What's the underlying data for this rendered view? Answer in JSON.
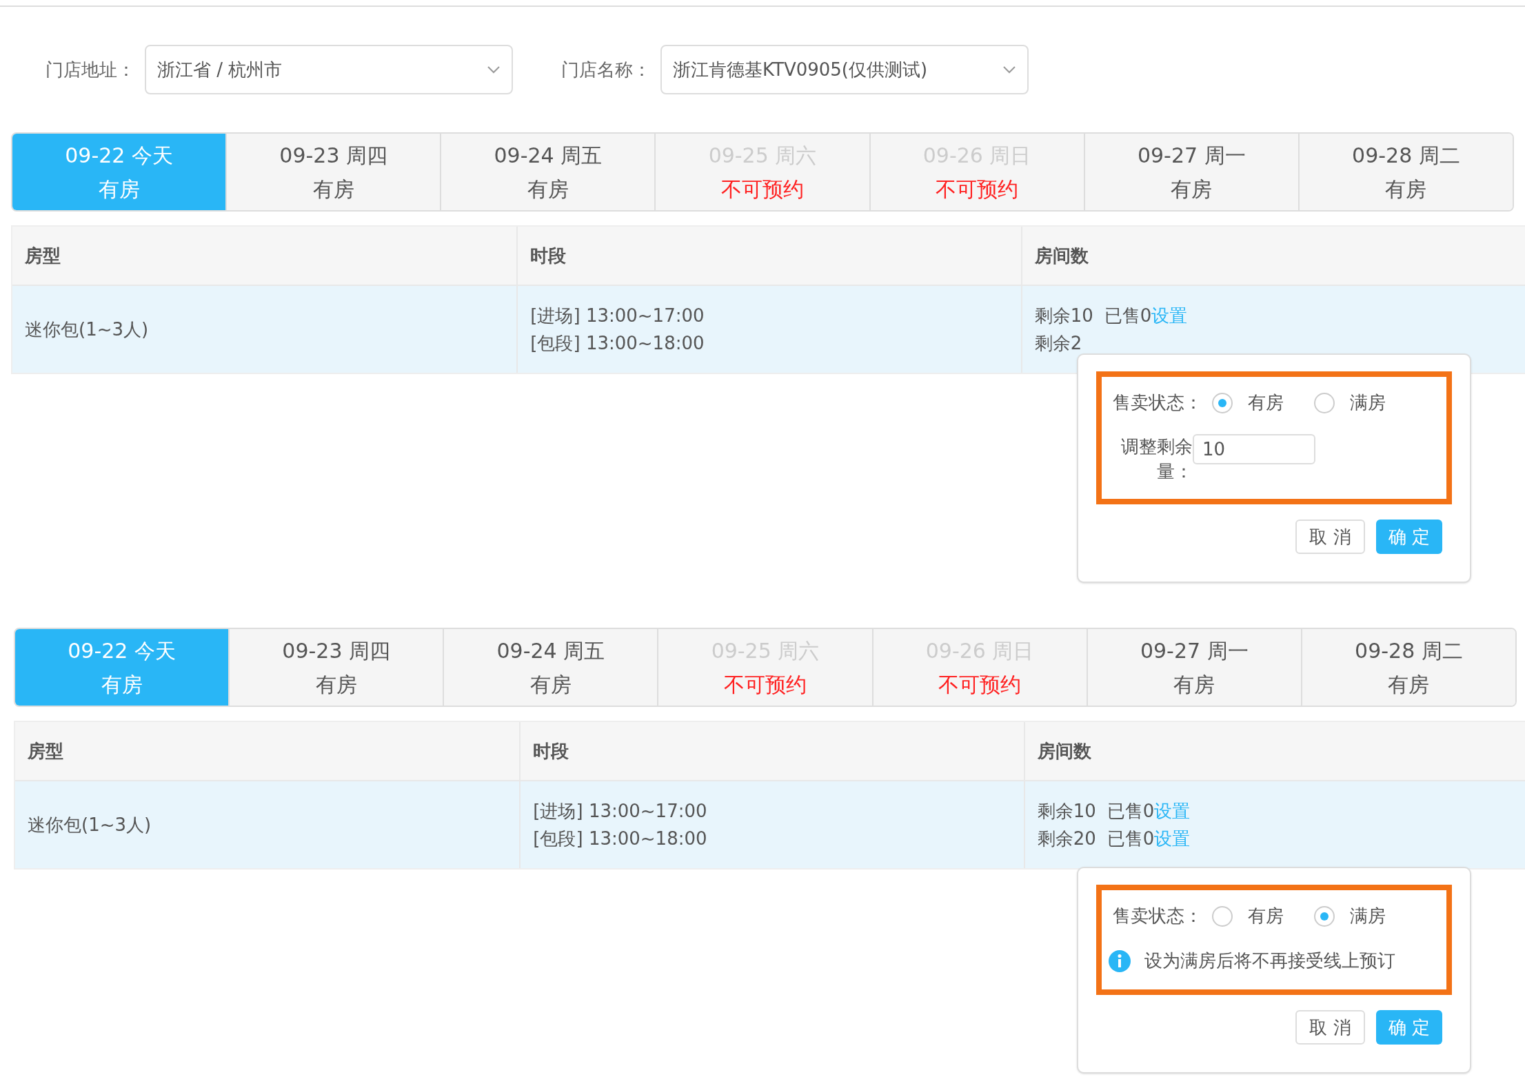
{
  "sections": [
    {
      "filters": [
        {
          "label": "门店地址：",
          "value": "浙江省 / 杭州市"
        },
        {
          "label": "门店名称：",
          "value": "浙江肯德基KTV0905(仅供测试)"
        }
      ],
      "date_tabs": [
        {
          "date": "09-22 今天",
          "status": "有房",
          "selected": true,
          "available": true
        },
        {
          "date": "09-23 周四",
          "status": "有房",
          "selected": false,
          "available": true
        },
        {
          "date": "09-24 周五",
          "status": "有房",
          "selected": false,
          "available": true
        },
        {
          "date": "09-25 周六",
          "status": "不可预约",
          "selected": false,
          "available": false
        },
        {
          "date": "09-26 周日",
          "status": "不可预约",
          "selected": false,
          "available": false
        },
        {
          "date": "09-27 周一",
          "status": "有房",
          "selected": false,
          "available": true
        },
        {
          "date": "09-28 周二",
          "status": "有房",
          "selected": false,
          "available": true
        }
      ],
      "table": {
        "columns": [
          "房型",
          "时段",
          "房间数"
        ],
        "rows": [
          {
            "room_type": "迷你包(1~3人)",
            "periods": [
              "[进场] 13:00~17:00",
              "[包段] 13:00~18:00"
            ],
            "counts": [
              {
                "remaining": "剩余10",
                "sold": "已售0",
                "link": "设置"
              },
              {
                "remaining": "剩余2"
              }
            ]
          }
        ]
      },
      "popover": {
        "label": "售卖状态：",
        "options": [
          {
            "label": "有房",
            "selected": true
          },
          {
            "label": "满房",
            "selected": false
          }
        ],
        "adjust": {
          "label": "调整剩余量：",
          "value": "10"
        },
        "buttons": [
          "取 消",
          "确 定"
        ]
      }
    },
    {
      "date_tabs": [
        {
          "date": "09-22 今天",
          "status": "有房",
          "selected": true,
          "available": true
        },
        {
          "date": "09-23 周四",
          "status": "有房",
          "selected": false,
          "available": true
        },
        {
          "date": "09-24 周五",
          "status": "有房",
          "selected": false,
          "available": true
        },
        {
          "date": "09-25 周六",
          "status": "不可预约",
          "selected": false,
          "available": false
        },
        {
          "date": "09-26 周日",
          "status": "不可预约",
          "selected": false,
          "available": false
        },
        {
          "date": "09-27 周一",
          "status": "有房",
          "selected": false,
          "available": true
        },
        {
          "date": "09-28 周二",
          "status": "有房",
          "selected": false,
          "available": true
        }
      ],
      "table": {
        "columns": [
          "房型",
          "时段",
          "房间数"
        ],
        "rows": [
          {
            "room_type": "迷你包(1~3人)",
            "periods": [
              "[进场] 13:00~17:00",
              "[包段] 13:00~18:00"
            ],
            "counts": [
              {
                "remaining": "剩余10",
                "sold": "已售0",
                "link": "设置"
              },
              {
                "remaining": "剩余20",
                "sold": "已售0",
                "link": "设置"
              }
            ]
          }
        ]
      },
      "popover": {
        "label": "售卖状态：",
        "options": [
          {
            "label": "有房",
            "selected": false
          },
          {
            "label": "满房",
            "selected": true
          }
        ],
        "notice": "设为满房后将不再接受线上预订",
        "buttons": [
          "取 消",
          "确 定"
        ]
      }
    }
  ]
}
